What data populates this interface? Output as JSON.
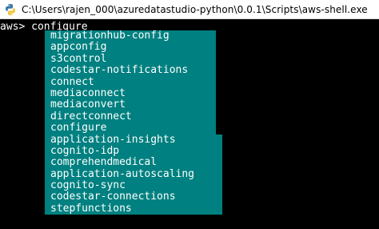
{
  "window": {
    "title": "C:\\Users\\rajen_000\\azuredatastudio-python\\0.0.1\\Scripts\\aws-shell.exe",
    "icon": "python-icon"
  },
  "terminal": {
    "prompt": "aws> ",
    "input": "configure",
    "colors": {
      "background": "#000000",
      "text": "#ffffff",
      "menu_background": "#008080"
    }
  },
  "completions": [
    "migrationhub-config",
    "appconfig",
    "s3control",
    "codestar-notifications",
    "connect",
    "mediaconnect",
    "mediaconvert",
    "directconnect",
    "configure",
    "application-insights",
    "cognito-idp",
    "comprehendmedical",
    "application-autoscaling",
    "cognito-sync",
    "codestar-connections",
    "stepfunctions"
  ]
}
